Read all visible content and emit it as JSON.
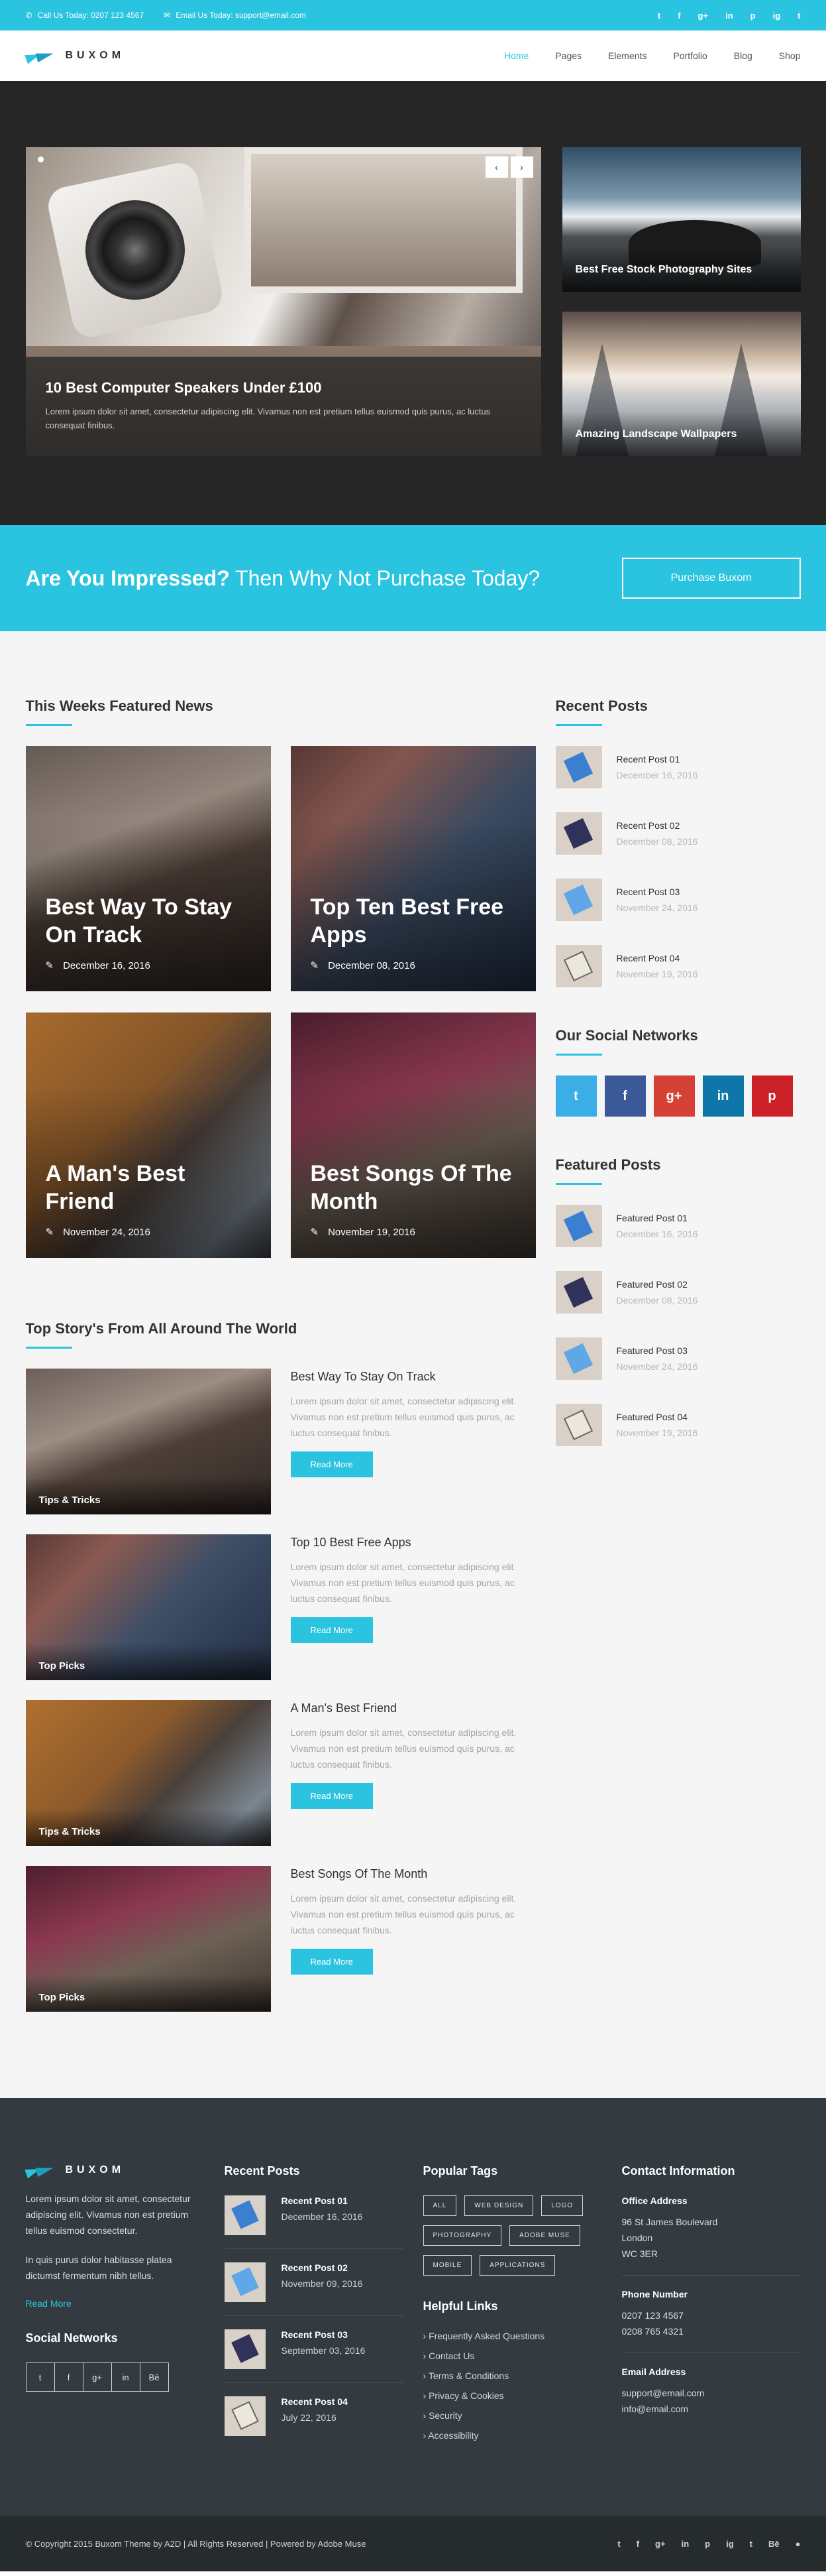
{
  "topbar": {
    "phone": "Call Us Today: 0207 123 4567",
    "email": "Email Us Today: support@email.com",
    "socials": [
      "t",
      "f",
      "g+",
      "in",
      "p",
      "ig",
      "t"
    ]
  },
  "header": {
    "logo": "BUXOM",
    "nav": [
      "Home",
      "Pages",
      "Elements",
      "Portfolio",
      "Blog",
      "Shop"
    ],
    "active": "Home"
  },
  "hero": {
    "main_title": "10 Best Computer Speakers Under £100",
    "main_text": "Lorem ipsum dolor sit amet, consectetur adipiscing elit. Vivamus non est pretium tellus euismod quis purus, ac luctus consequat finibus.",
    "side1": "Best Free Stock Photography Sites",
    "side2": "Amazing Landscape Wallpapers",
    "prev": "‹",
    "next": "›"
  },
  "cta": {
    "bold": "Are You Impressed?",
    "light": " Then Why Not Purchase Today?",
    "button": "Purchase Buxom"
  },
  "featured": {
    "title": "This Weeks Featured News",
    "items": [
      {
        "title": "Best Way To Stay On Track",
        "date": "December 16, 2016"
      },
      {
        "title": "Top Ten Best Free Apps",
        "date": "December 08, 2016"
      },
      {
        "title": "A Man's Best Friend",
        "date": "November 24, 2016"
      },
      {
        "title": "Best Songs Of The Month",
        "date": "November 19, 2016"
      }
    ]
  },
  "stories": {
    "title": "Top Story's From All Around The World",
    "read_more": "Read More",
    "items": [
      {
        "tag": "Tips & Tricks",
        "title": "Best Way To Stay On Track",
        "text": "Lorem ipsum dolor sit amet, consectetur adipiscing elit. Vivamus non est pretium tellus euismod quis purus, ac luctus consequat finibus."
      },
      {
        "tag": "Top Picks",
        "title": "Top 10 Best Free Apps",
        "text": "Lorem ipsum dolor sit amet, consectetur adipiscing elit. Vivamus non est pretium tellus euismod quis purus, ac luctus consequat finibus."
      },
      {
        "tag": "Tips & Tricks",
        "title": "A Man's Best Friend",
        "text": "Lorem ipsum dolor sit amet, consectetur adipiscing elit. Vivamus non est pretium tellus euismod quis purus, ac luctus consequat finibus."
      },
      {
        "tag": "Top Picks",
        "title": "Best Songs Of The Month",
        "text": "Lorem ipsum dolor sit amet, consectetur adipiscing elit. Vivamus non est pretium tellus euismod quis purus, ac luctus consequat finibus."
      }
    ]
  },
  "sidebar": {
    "recent_title": "Recent Posts",
    "recent": [
      {
        "title": "Recent Post 01",
        "date": "December 16, 2016"
      },
      {
        "title": "Recent Post 02",
        "date": "December 08, 2016"
      },
      {
        "title": "Recent Post 03",
        "date": "November 24, 2016"
      },
      {
        "title": "Recent Post 04",
        "date": "November 19, 2016"
      }
    ],
    "social_title": "Our Social Networks",
    "social": [
      {
        "icon": "t",
        "color": "#3aaee5"
      },
      {
        "icon": "f",
        "color": "#3b5998"
      },
      {
        "icon": "g+",
        "color": "#d64136"
      },
      {
        "icon": "in",
        "color": "#0e76a8"
      },
      {
        "icon": "p",
        "color": "#cb2027"
      }
    ],
    "featured_title": "Featured Posts",
    "featured": [
      {
        "title": "Featured Post 01",
        "date": "December 16, 2016"
      },
      {
        "title": "Featured Post 02",
        "date": "December 08, 2016"
      },
      {
        "title": "Featured Post 03",
        "date": "November 24, 2016"
      },
      {
        "title": "Featured Post 04",
        "date": "November 19, 2016"
      }
    ]
  },
  "footer": {
    "logo": "BUXOM",
    "about1": "Lorem ipsum dolor sit amet, consectetur adipiscing elit. Vivamus non est pretium tellus euismod consectetur.",
    "about2": "In quis purus dolor habitasse platea dictumst fermentum nibh tellus.",
    "read_more": "Read More",
    "social_title": "Social Networks",
    "social": [
      "t",
      "f",
      "g+",
      "in",
      "Bē"
    ],
    "recent_title": "Recent Posts",
    "recent": [
      {
        "title": "Recent Post 01",
        "date": "December 16, 2016"
      },
      {
        "title": "Recent Post 02",
        "date": "November 09, 2016"
      },
      {
        "title": "Recent Post 03",
        "date": "September 03, 2016"
      },
      {
        "title": "Recent Post 04",
        "date": "July 22, 2016"
      }
    ],
    "tags_title": "Popular Tags",
    "tags": [
      "ALL",
      "WEB DESIGN",
      "LOGO",
      "PHOTOGRAPHY",
      "ADOBE MUSE",
      "MOBILE",
      "APPLICATIONS"
    ],
    "links_title": "Helpful Links",
    "links": [
      "Frequently Asked Questions",
      "Contact Us",
      "Terms & Conditions",
      "Privacy & Cookies",
      "Security",
      "Accessibility"
    ],
    "contact_title": "Contact Information",
    "office_label": "Office Address",
    "office": [
      "96 St James Boulevard",
      "London",
      "WC 3ER"
    ],
    "phone_label": "Phone Number",
    "phones": [
      "0207 123 4567",
      "0208 765 4321"
    ],
    "email_label": "Email Address",
    "emails": [
      "support@email.com",
      "info@email.com"
    ]
  },
  "bottom": {
    "copyright": "© Copyright 2015 Buxom Theme by A2D | All Rights Reserved | Powered by Adobe Muse",
    "socials": [
      "t",
      "f",
      "g+",
      "in",
      "p",
      "ig",
      "t",
      "Bē",
      "●"
    ]
  }
}
